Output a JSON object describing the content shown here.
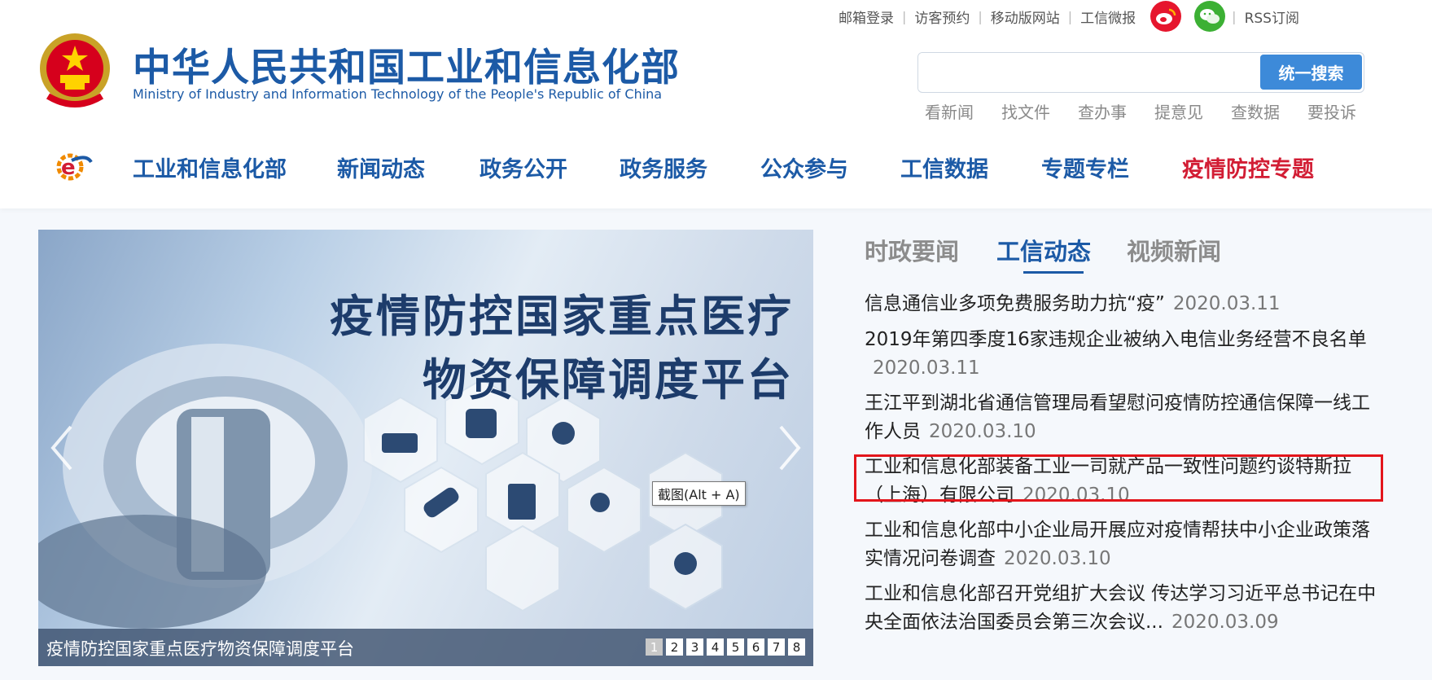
{
  "top_links": [
    "邮箱登录",
    "访客预约",
    "移动版网站",
    "工信微报",
    "RSS订阅"
  ],
  "logo": {
    "cn": "中华人民共和国工业和信息化部",
    "en": "Ministry of Industry and Information Technology of the People's Republic of China"
  },
  "search": {
    "placeholder": "",
    "button": "统一搜索",
    "quick_links": [
      "看新闻",
      "找文件",
      "查办事",
      "提意见",
      "查数据",
      "要投诉"
    ]
  },
  "nav": [
    "工业和信息化部",
    "新闻动态",
    "政务公开",
    "政务服务",
    "公众参与",
    "工信数据",
    "专题专栏",
    "疫情防控专题"
  ],
  "carousel": {
    "slide_title_line1": "疫情防控国家重点医疗",
    "slide_title_line2": "物资保障调度平台",
    "caption": "疫情防控国家重点医疗物资保障调度平台",
    "pages": [
      "1",
      "2",
      "3",
      "4",
      "5",
      "6",
      "7",
      "8"
    ],
    "active_page": 1
  },
  "tooltip": "截图(Alt + A)",
  "news_tabs": [
    "时政要闻",
    "工信动态",
    "视频新闻"
  ],
  "active_tab": "工信动态",
  "news": [
    {
      "title": "信息通信业多项免费服务助力抗“疫”",
      "date": "2020.03.11"
    },
    {
      "title": "2019年第四季度16家违规企业被纳入电信业务经营不良名单",
      "date": "2020.03.11"
    },
    {
      "title": "王江平到湖北省通信管理局看望慰问疫情防控通信保障一线工作人员",
      "date": "2020.03.10"
    },
    {
      "title": "工业和信息化部装备工业一司就产品一致性问题约谈特斯拉（上海）有限公司",
      "date": "2020.03.10"
    },
    {
      "title": "工业和信息化部中小企业局开展应对疫情帮扶中小企业政策落实情况问卷调查",
      "date": "2020.03.10"
    },
    {
      "title": "工业和信息化部召开党组扩大会议 传达学习习近平总书记在中央全面依法治国委员会第三次会议...",
      "date": "2020.03.09"
    }
  ],
  "colors": {
    "brand_blue": "#1c5aa6",
    "special_red": "#d21d34",
    "highlight_red": "#e3151b"
  }
}
